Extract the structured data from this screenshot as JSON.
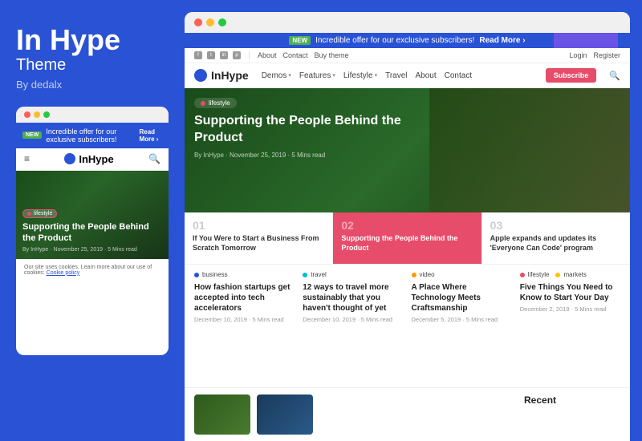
{
  "brand": {
    "title": "In Hype",
    "subtitle": "Theme",
    "by": "By dedalx"
  },
  "topBanner": {
    "new_label": "NEW",
    "message": "Incredible offer for our exclusive subscribers!",
    "read_more": "Read More ›"
  },
  "utilityBar": {
    "links": [
      "About",
      "Contact",
      "Buy theme"
    ],
    "auth": [
      "Login",
      "Register"
    ]
  },
  "nav": {
    "logo": "InHype",
    "links": [
      {
        "label": "Demos",
        "has_dropdown": true
      },
      {
        "label": "Features",
        "has_dropdown": true
      },
      {
        "label": "Lifestyle",
        "has_dropdown": true
      },
      {
        "label": "Travel",
        "has_dropdown": false
      },
      {
        "label": "About",
        "has_dropdown": false
      },
      {
        "label": "Contact",
        "has_dropdown": false
      }
    ],
    "subscribe": "Subscribe"
  },
  "hero": {
    "tag": "lifestyle",
    "title": "Supporting the People Behind the Product",
    "meta": "By InHype  ·  November 25, 2019  ·  5 Mins read"
  },
  "relatedArticles": [
    {
      "num": "01",
      "title": "If You Were to Start a Business From Scratch Tomorrow",
      "highlighted": false
    },
    {
      "num": "02",
      "title": "Supporting the People Behind the Product",
      "highlighted": true
    },
    {
      "num": "03",
      "title": "Apple expands and updates its 'Everyone Can Code' program",
      "highlighted": false
    }
  ],
  "articles": [
    {
      "tag": "business",
      "tag_color": "blue",
      "title": "How fashion startups get accepted into tech accelerators",
      "meta": "December 10, 2019 · 5 Mins read"
    },
    {
      "tag": "travel",
      "tag_color": "cyan",
      "title": "12 ways to travel more sustainably that you haven't thought of yet",
      "meta": "December 10, 2019 · 5 Mins read"
    },
    {
      "tag": "video",
      "tag_color": "orange",
      "title": "A Place Where Technology Meets Craftsmanship",
      "meta": "December 5, 2019 · 5 Mins read"
    },
    {
      "tag": "lifestyle",
      "tag_color": "red",
      "tag2": "markets",
      "tag2_color": "yellow",
      "title": "Five Things You Need to Know to Start Your Day",
      "meta": "December 2, 2019 · 5 Mins read"
    }
  ],
  "recent": {
    "label": "Recent"
  },
  "mobile": {
    "banner_message": "Incredible offer for our exclusive subscribers!",
    "read_more": "Read More ›",
    "new_label": "NEW",
    "logo": "InHype",
    "hero_tag": "lifestyle",
    "hero_title": "Supporting the People Behind the Product",
    "hero_meta": "By InHype  ·  November 25, 2019  ·  5 Mins read",
    "cookie_text": "Our site uses cookies. Learn more about our use of cookies:",
    "cookie_link": "Cookie policy"
  },
  "dots": {
    "colors": [
      "#ff5f57",
      "#febc2e",
      "#28c840"
    ]
  }
}
